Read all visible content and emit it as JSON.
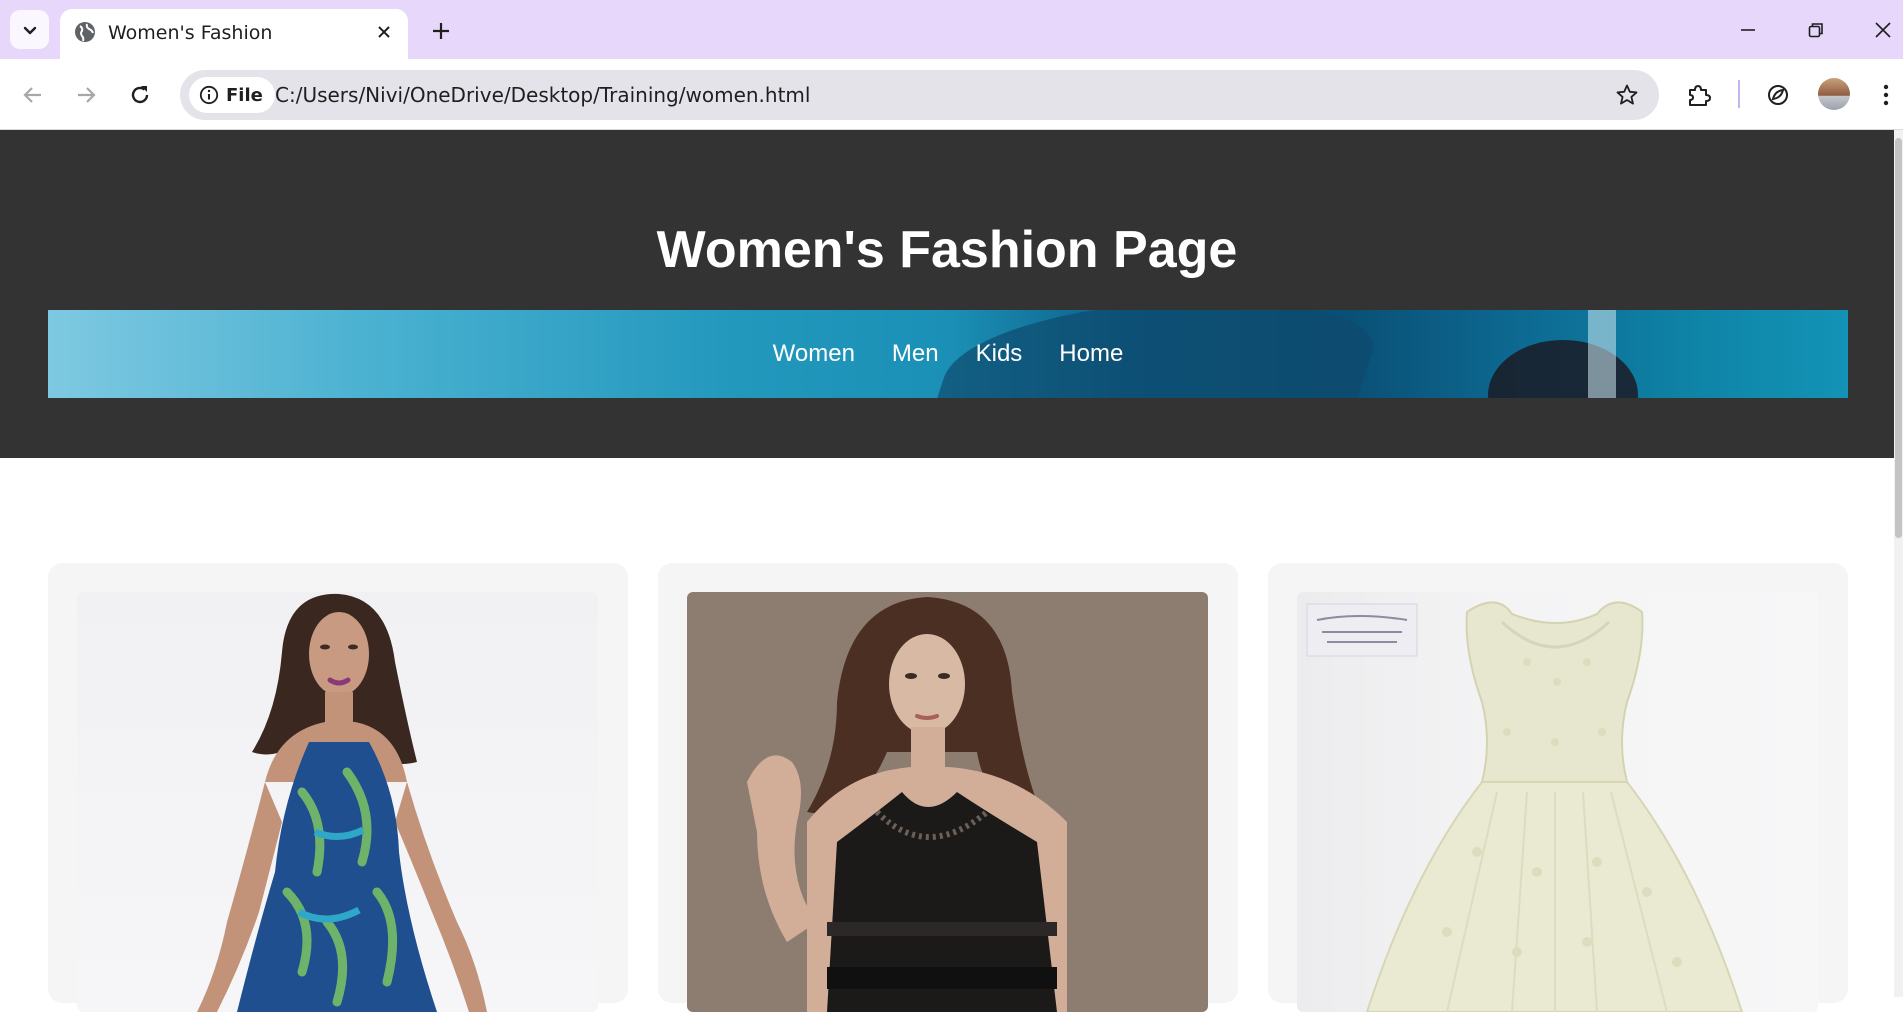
{
  "browser": {
    "tab_title": "Women's Fashion",
    "chip_label": "File",
    "url": "C:/Users/Nivi/OneDrive/Desktop/Training/women.html"
  },
  "page": {
    "title": "Women's Fashion Page",
    "nav": [
      "Women",
      "Men",
      "Kids",
      "Home"
    ]
  },
  "products": [
    {
      "image": "model-floral-halter-dress"
    },
    {
      "image": "model-black-beaded-dress"
    },
    {
      "image": "white-lace-vintage-dress"
    }
  ],
  "colors": {
    "tabstrip": "#e7d7fb",
    "header_bg": "#333333",
    "card_bg": "#f5f5f6"
  }
}
